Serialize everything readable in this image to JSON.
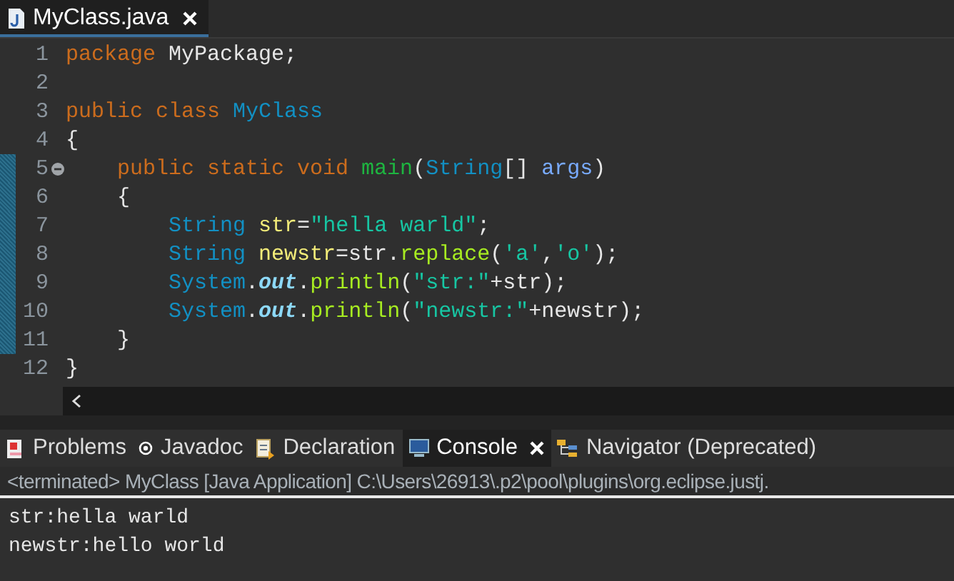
{
  "editor_tab": {
    "title": "MyClass.java",
    "selected": true
  },
  "lines": [
    {
      "number": "1",
      "changed": false,
      "foldable": false,
      "tokens": [
        {
          "kind": "keyword",
          "text": "package"
        },
        {
          "kind": "plain",
          "text": " MyPackage;"
        }
      ]
    },
    {
      "number": "2",
      "changed": false,
      "foldable": false
    },
    {
      "number": "3",
      "changed": false,
      "foldable": false,
      "tokens": [
        {
          "kind": "keyword",
          "text": "public class "
        },
        {
          "kind": "type",
          "text": "MyClass"
        }
      ]
    },
    {
      "number": "4",
      "changed": false,
      "foldable": false,
      "tokens": [
        {
          "kind": "plain",
          "text": "{"
        }
      ]
    },
    {
      "number": "5",
      "changed": true,
      "foldable": true,
      "tokens": [
        {
          "kind": "keyword",
          "text": "    public static void "
        },
        {
          "kind": "method-decl",
          "text": "main"
        },
        {
          "kind": "plain",
          "text": "("
        },
        {
          "kind": "type",
          "text": "String"
        },
        {
          "kind": "plain",
          "text": "[] "
        },
        {
          "kind": "param",
          "text": "args"
        },
        {
          "kind": "plain",
          "text": ")"
        }
      ]
    },
    {
      "number": "6",
      "changed": true,
      "foldable": false,
      "tokens": [
        {
          "kind": "plain",
          "text": "    {"
        }
      ]
    },
    {
      "number": "7",
      "changed": true,
      "foldable": false,
      "tokens": [
        {
          "kind": "type",
          "text": "        String "
        },
        {
          "kind": "local",
          "text": "str"
        },
        {
          "kind": "plain",
          "text": "="
        },
        {
          "kind": "string",
          "text": "\"hella warld\""
        },
        {
          "kind": "plain",
          "text": ";"
        }
      ]
    },
    {
      "number": "8",
      "changed": true,
      "foldable": false,
      "tokens": [
        {
          "kind": "type",
          "text": "        String "
        },
        {
          "kind": "local",
          "text": "newstr"
        },
        {
          "kind": "plain",
          "text": "=str."
        },
        {
          "kind": "method",
          "text": "replace"
        },
        {
          "kind": "plain",
          "text": "("
        },
        {
          "kind": "string",
          "text": "'a'"
        },
        {
          "kind": "plain",
          "text": ","
        },
        {
          "kind": "string",
          "text": "'o'"
        },
        {
          "kind": "plain",
          "text": ");"
        }
      ]
    },
    {
      "number": "9",
      "changed": true,
      "foldable": false,
      "tokens": [
        {
          "kind": "type",
          "text": "        System"
        },
        {
          "kind": "plain",
          "text": "."
        },
        {
          "kind": "field",
          "text": "out"
        },
        {
          "kind": "plain",
          "text": "."
        },
        {
          "kind": "method",
          "text": "println"
        },
        {
          "kind": "plain",
          "text": "("
        },
        {
          "kind": "string",
          "text": "\"str:\""
        },
        {
          "kind": "plain",
          "text": "+str);"
        }
      ]
    },
    {
      "number": "10",
      "changed": true,
      "foldable": false,
      "tokens": [
        {
          "kind": "type",
          "text": "        System"
        },
        {
          "kind": "plain",
          "text": "."
        },
        {
          "kind": "field",
          "text": "out"
        },
        {
          "kind": "plain",
          "text": "."
        },
        {
          "kind": "method",
          "text": "println"
        },
        {
          "kind": "plain",
          "text": "("
        },
        {
          "kind": "string",
          "text": "\"newstr:\""
        },
        {
          "kind": "plain",
          "text": "+newstr);"
        }
      ]
    },
    {
      "number": "11",
      "changed": true,
      "foldable": false,
      "tokens": [
        {
          "kind": "plain",
          "text": "    }"
        }
      ]
    },
    {
      "number": "12",
      "changed": false,
      "foldable": false,
      "tokens": [
        {
          "kind": "plain",
          "text": "}"
        }
      ]
    }
  ],
  "panel_tabs": [
    {
      "kind": "problems",
      "label": "Problems",
      "selected": false,
      "closable": false
    },
    {
      "kind": "javadoc",
      "label": "Javadoc",
      "selected": false,
      "closable": false
    },
    {
      "kind": "declaration",
      "label": "Declaration",
      "selected": false,
      "closable": false
    },
    {
      "kind": "console",
      "label": "Console",
      "selected": true,
      "closable": true
    },
    {
      "kind": "navigator",
      "label": "Navigator (Deprecated)",
      "selected": false,
      "closable": false
    }
  ],
  "console": {
    "status": "<terminated> MyClass [Java Application] C:\\Users\\26913\\.p2\\pool\\plugins\\org.eclipse.justj.",
    "output": [
      "str:hella warld",
      "newstr:hello world"
    ]
  }
}
